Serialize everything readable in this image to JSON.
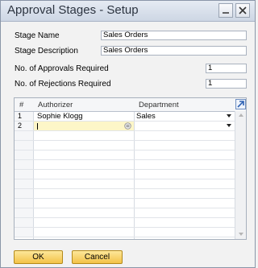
{
  "window": {
    "title": "Approval Stages - Setup"
  },
  "form": {
    "stage_name_label": "Stage Name",
    "stage_name_value": "Sales Orders",
    "stage_description_label": "Stage Description",
    "stage_description_value": "Sales Orders",
    "approvals_label": "No. of Approvals Required",
    "approvals_value": "1",
    "rejections_label": "No. of Rejections Required",
    "rejections_value": "1"
  },
  "grid": {
    "columns": [
      "#",
      "Authorizer",
      "Department"
    ],
    "rows": [
      {
        "num": "1",
        "authorizer": "Sophie Klogg",
        "department": "Sales"
      },
      {
        "num": "2",
        "authorizer": "",
        "department": ""
      }
    ]
  },
  "buttons": {
    "ok": "OK",
    "cancel": "Cancel"
  },
  "colors": {
    "accent_button": "#f3c248",
    "active_row": "#fdf6c8"
  }
}
